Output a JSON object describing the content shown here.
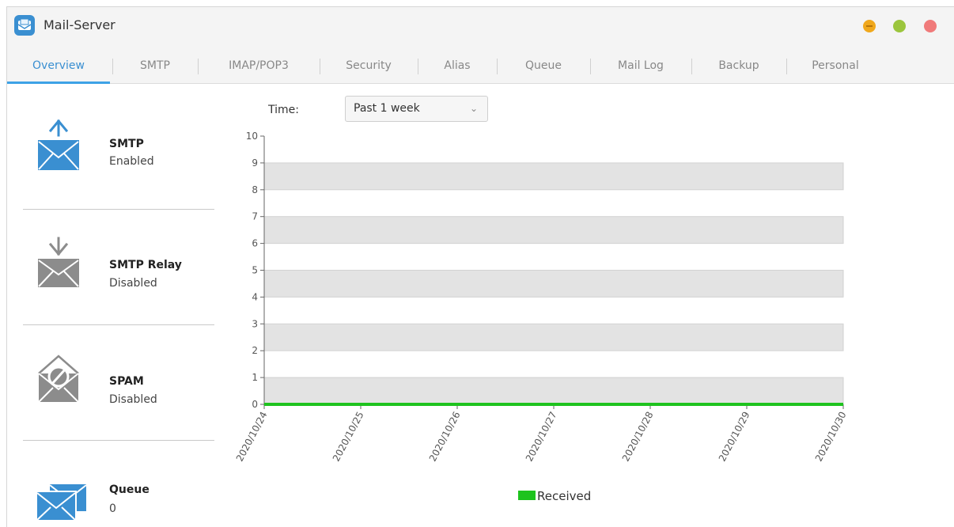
{
  "app": {
    "title": "Mail-Server",
    "accent_color": "#3ea2e6",
    "window_controls": [
      {
        "name": "minimize",
        "color": "#f0a81c"
      },
      {
        "name": "maximize",
        "color": "#9bc53d"
      },
      {
        "name": "close",
        "color": "#f07a7a"
      }
    ]
  },
  "tabs": [
    {
      "label": "Overview",
      "active": true
    },
    {
      "label": "SMTP",
      "active": false
    },
    {
      "label": "IMAP/POP3",
      "active": false
    },
    {
      "label": "Security",
      "active": false
    },
    {
      "label": "Alias",
      "active": false
    },
    {
      "label": "Queue",
      "active": false
    },
    {
      "label": "Mail Log",
      "active": false
    },
    {
      "label": "Backup",
      "active": false
    },
    {
      "label": "Personal",
      "active": false
    }
  ],
  "sidebar": {
    "items": [
      {
        "name": "SMTP",
        "status": "Enabled",
        "icon": "mail-send-icon",
        "color": "#3a8fd1"
      },
      {
        "name": "SMTP Relay",
        "status": "Disabled",
        "icon": "mail-receive-icon",
        "color": "#8c8c8c"
      },
      {
        "name": "SPAM",
        "status": "Disabled",
        "icon": "spam-filter-icon",
        "color": "#8c8c8c"
      },
      {
        "name": "Queue",
        "status": "0",
        "icon": "mail-queue-icon",
        "color": "#3a8fd1"
      }
    ]
  },
  "filter": {
    "label": "Time:",
    "selected": "Past 1 week"
  },
  "chart_data": {
    "type": "line",
    "x": [
      "2020/10/24",
      "2020/10/25",
      "2020/10/26",
      "2020/10/27",
      "2020/10/28",
      "2020/10/29",
      "2020/10/30"
    ],
    "series": [
      {
        "name": "Received",
        "values": [
          0,
          0,
          0,
          0,
          0,
          0,
          0
        ],
        "color": "#1ec31e"
      }
    ],
    "ylim": [
      0,
      10
    ],
    "yticks": [
      0,
      1,
      2,
      3,
      4,
      5,
      6,
      7,
      8,
      9,
      10
    ],
    "grid": "alternating bands",
    "band_color": "#e3e3e3",
    "legend": "bottom-center"
  }
}
